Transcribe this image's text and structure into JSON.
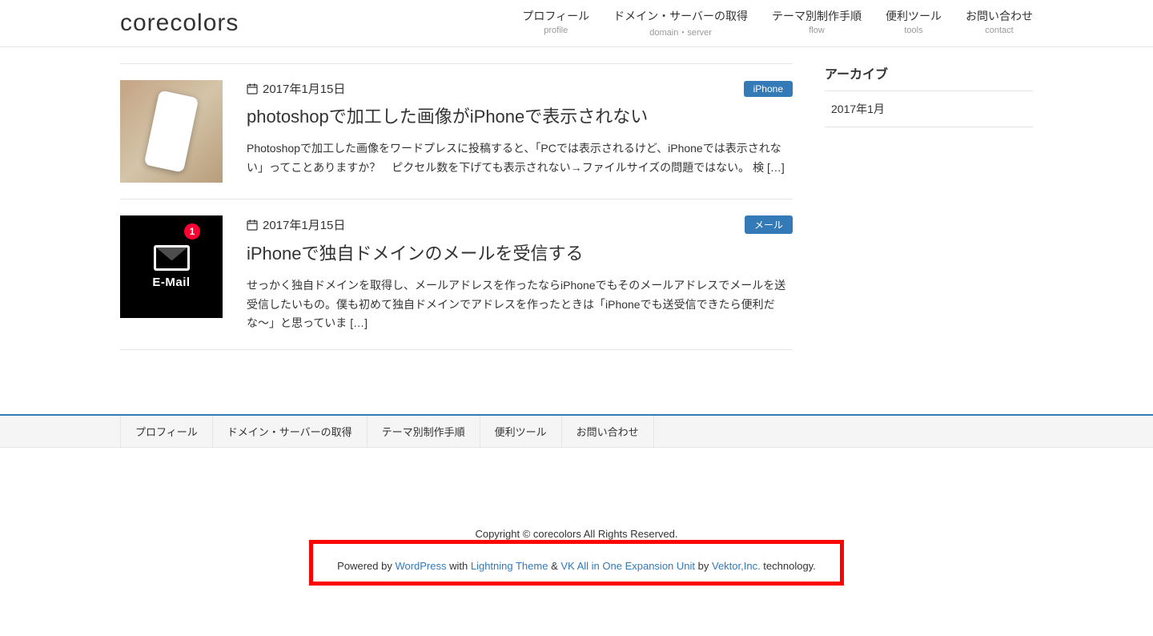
{
  "header": {
    "logo": "corecolors",
    "nav": [
      {
        "title": "プロフィール",
        "sub": "profile"
      },
      {
        "title": "ドメイン・サーバーの取得",
        "sub": "domain・server"
      },
      {
        "title": "テーマ別制作手順",
        "sub": "flow"
      },
      {
        "title": "便利ツール",
        "sub": "tools"
      },
      {
        "title": "お問い合わせ",
        "sub": "contact"
      }
    ]
  },
  "posts": [
    {
      "date": "2017年1月15日",
      "badge": "iPhone",
      "title": "photoshopで加工した画像がiPhoneで表示されない",
      "excerpt": "Photoshopで加工した画像をワードプレスに投稿すると、「PCでは表示されるけど、iPhoneでは表示されない」ってことありますか？　ピクセル数を下げても表示されない→ファイルサイズの問題ではない。 検 […]",
      "thumb": "phone"
    },
    {
      "date": "2017年1月15日",
      "badge": "メール",
      "title": "iPhoneで独自ドメインのメールを受信する",
      "excerpt": "せっかく独自ドメインを取得し、メールアドレスを作ったならiPhoneでもそのメールアドレスでメールを送受信したいもの。僕も初めて独自ドメインでアドレスを作ったときは「iPhoneでも送受信できたら便利だな〜」と思っていま […]",
      "thumb": "email",
      "email_badge": "1",
      "email_text": "E-Mail"
    }
  ],
  "sidebar": {
    "archive_title": "アーカイブ",
    "archive_item": "2017年1月"
  },
  "footer": {
    "nav": [
      "プロフィール",
      "ドメイン・サーバーの取得",
      "テーマ別制作手順",
      "便利ツール",
      "お問い合わせ"
    ],
    "copyright": "Copyright © corecolors All Rights Reserved.",
    "powered": {
      "pre": "Powered by ",
      "wp": "WordPress",
      "with": " with ",
      "theme": "Lightning Theme",
      "amp": " & ",
      "vk": "VK All in One Expansion Unit",
      "by": " by ",
      "vektor": "Vektor,Inc.",
      "tech": " technology."
    }
  }
}
